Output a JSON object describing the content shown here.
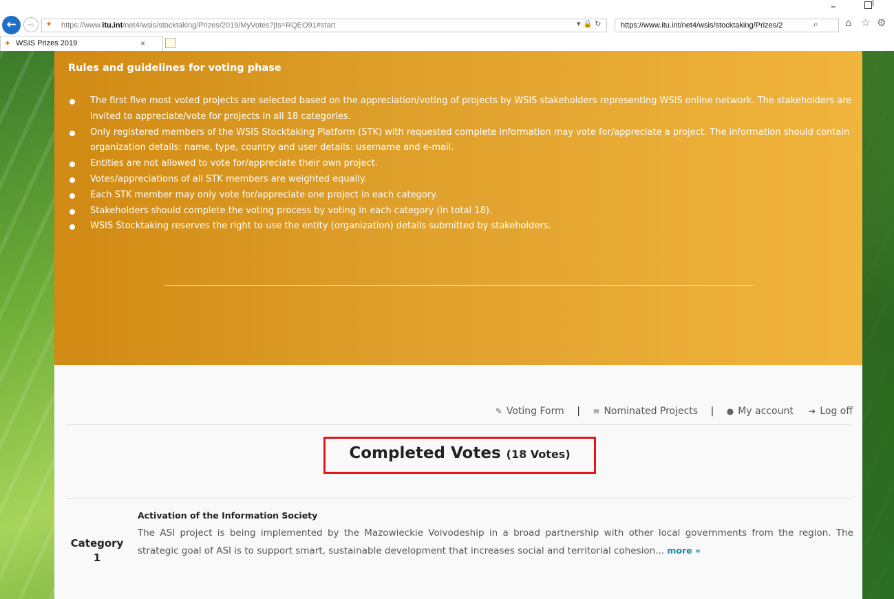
{
  "browser": {
    "url": "https://www.itu.int/net4/wsis/stocktaking/Prizes/2019/MyVotes?jts=RQEO91#start",
    "url_host": "itu.int",
    "url_prefix": "https://www.",
    "url_rest": "/net4/wsis/stocktaking/Prizes/2019/MyVotes?jts=RQEO91#start",
    "search_text": "https://www.itu.int/net4/wsis/stocktaking/Prizes/2",
    "tab_title": "WSIS Prizes 2019",
    "window_min": "–"
  },
  "rules": {
    "title": "Rules and guidelines for voting phase",
    "items": [
      "The first five most voted projects are selected based on the appreciation/voting of projects by WSIS stakeholders representing WSIS online network. The stakeholders are invited to appreciate/vote for projects in all 18 categories.",
      "Only registered members of the WSIS Stocktaking Platform (STK) with requested complete information may vote for/appreciate a project. The information should contain organization details: name, type, country and user details: username and e-mail.",
      "Entities are not allowed to vote for/appreciate their own project.",
      "Votes/appreciations of all STK members are weighted equally.",
      "Each STK member may only vote for/appreciate one project in each category.",
      "Stakeholders should complete the voting process by voting in each category (in total 18).",
      "WSIS Stocktaking reserves the right to use the entity (organization) details submitted by stakeholders."
    ]
  },
  "nav": {
    "voting_form": "Voting Form",
    "nominated_projects": "Nominated Projects",
    "my_account": "My account",
    "log_off": "Log off",
    "separator": "|"
  },
  "votes": {
    "heading": "Completed Votes",
    "count": "(18 Votes)"
  },
  "category_entry": {
    "category_word": "Category",
    "category_number": "1",
    "project_title": "Activation of the Information Society",
    "description": "The ASI project is being implemented by the Mazowieckie Voivodeship in a broad partnership with other local governments from the region. The strategic goal of ASI is to support smart, sustainable development that increases social and territorial cohesion...",
    "more_label": "more »"
  },
  "icons": [
    "back-icon",
    "forward-icon",
    "favicon-icon",
    "lock-icon",
    "refresh-icon",
    "search-icon",
    "home-icon",
    "star-icon",
    "gear-icon",
    "close-icon",
    "new-tab-icon",
    "edit-icon",
    "list-icon",
    "user-icon",
    "logout-icon"
  ],
  "colors": {
    "panel_orange_start": "#d18a13",
    "panel_orange_end": "#f1b43c",
    "highlight_red": "#e0161b",
    "link_teal": "#1d8a9e"
  }
}
